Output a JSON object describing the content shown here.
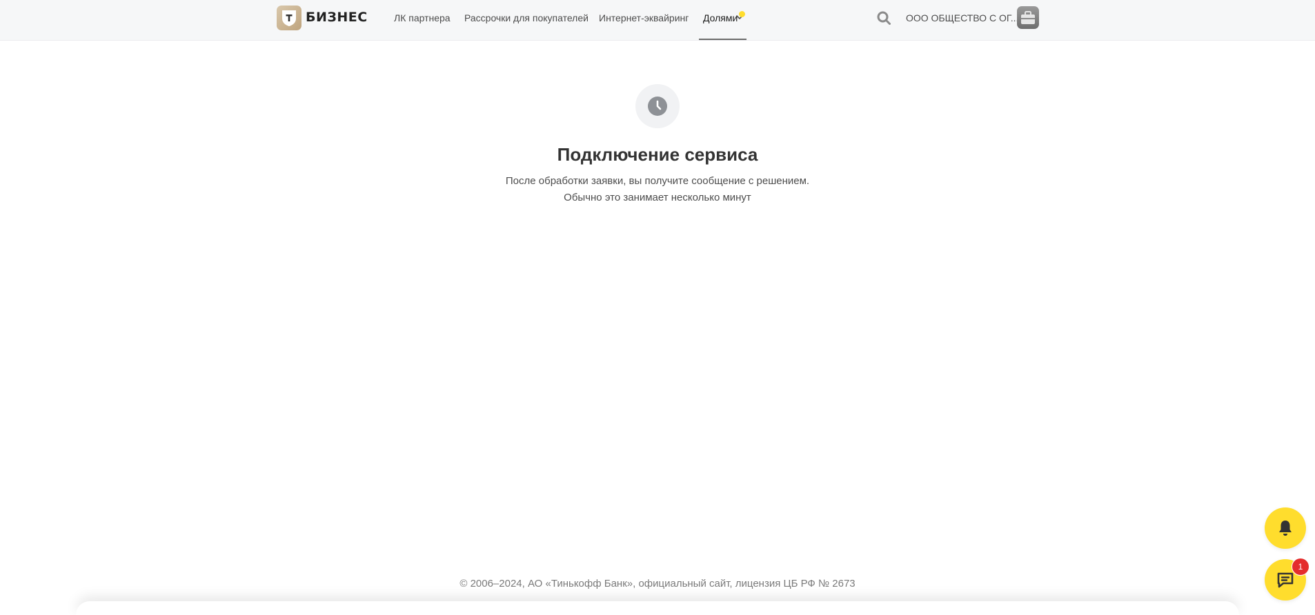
{
  "header": {
    "brand": "БИЗНЕС",
    "nav": [
      {
        "label": "ЛК партнера"
      },
      {
        "label": "Рассрочки для покупателей"
      },
      {
        "label": "Интернет-эквайринг"
      },
      {
        "label": "Долями"
      }
    ],
    "active_nav": "Долями",
    "org_name": "ООО ОБЩЕСТВО С ОГ...",
    "icons": {
      "logo": "shield-logo-icon",
      "search": "search-icon",
      "avatar": "briefcase-icon",
      "chevron": "chevron-down-icon"
    }
  },
  "main": {
    "status_icon": "clock-icon",
    "title": "Подключение сервиса",
    "description_line1": "После обработки заявки, вы получите сообщение с решением.",
    "description_line2": "Обычно это занимает несколько минут"
  },
  "footer": {
    "copyright": "© 2006–2024, АО «Тинькофф Банк», официальный сайт, лицензия ЦБ РФ № 2673"
  },
  "floating": {
    "notifications_icon": "bell-icon",
    "chat_icon": "chat-icon",
    "chat_badge": "1"
  },
  "colors": {
    "accent": "#ffdd2d",
    "badge": "#e42d2d",
    "header_bg": "#f6f7f8"
  }
}
